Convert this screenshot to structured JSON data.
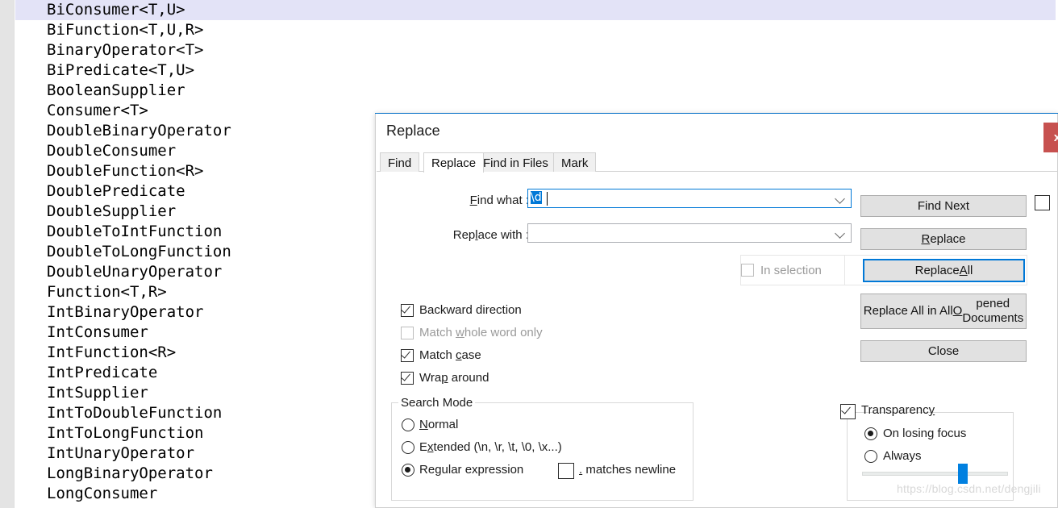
{
  "editor": {
    "lines": [
      "BiConsumer<T,U>",
      "BiFunction<T,U,R>",
      "BinaryOperator<T>",
      "BiPredicate<T,U>",
      "BooleanSupplier",
      "Consumer<T>",
      "DoubleBinaryOperator",
      "DoubleConsumer",
      "DoubleFunction<R>",
      "DoublePredicate",
      "DoubleSupplier",
      "DoubleToIntFunction",
      "DoubleToLongFunction",
      "DoubleUnaryOperator",
      "Function<T,R>",
      "IntBinaryOperator",
      "IntConsumer",
      "IntFunction<R>",
      "IntPredicate",
      "IntSupplier",
      "IntToDoubleFunction",
      "IntToLongFunction",
      "IntUnaryOperator",
      "LongBinaryOperator",
      "LongConsumer"
    ],
    "selected_line_index": 0,
    "selection_color": "#e3e3f7",
    "margin_color": "#e4e4e4"
  },
  "dialog": {
    "title": "Replace",
    "accent_color": "#0078d7",
    "close_label": "x",
    "close_color": "#c7514f",
    "tabs": [
      {
        "label": "Find",
        "active": false
      },
      {
        "label": "Replace",
        "active": true
      },
      {
        "label": "Find in Files",
        "active": false
      },
      {
        "label": "Mark",
        "active": false
      }
    ],
    "fields": {
      "find_what_label": "Find what :",
      "find_what_value": "\\d",
      "find_what_placeholder": "",
      "replace_with_label": "Replace with :",
      "replace_with_value": "",
      "replace_with_placeholder": ""
    },
    "buttons": {
      "find_next": "Find Next",
      "replace": "Replace",
      "replace_all": "Replace All",
      "replace_all_opened": "Replace All in All Opened Documents",
      "close": "Close"
    },
    "checkboxes": {
      "backward_direction": {
        "label": "Backward direction",
        "checked": true,
        "enabled": true
      },
      "match_whole_word": {
        "label": "Match whole word only",
        "checked": false,
        "enabled": false
      },
      "match_case": {
        "label": "Match case",
        "checked": true,
        "enabled": true
      },
      "wrap_around": {
        "label": "Wrap around",
        "checked": true,
        "enabled": true
      },
      "in_selection": {
        "label": "In selection",
        "checked": false,
        "enabled": false
      },
      "unlabeled_right": {
        "label": "",
        "checked": false,
        "enabled": true
      }
    },
    "search_mode": {
      "title": "Search Mode",
      "options": [
        {
          "label": "Normal",
          "selected": false
        },
        {
          "label": "Extended (\\n, \\r, \\t, \\0, \\x...)",
          "selected": false
        },
        {
          "label": "Regular expression",
          "selected": true
        }
      ],
      "dot_matches_newline": {
        "label": ". matches newline",
        "checked": false
      }
    },
    "transparency": {
      "label": "Transparency",
      "checked": true,
      "options": [
        {
          "label": "On losing focus",
          "selected": true
        },
        {
          "label": "Always",
          "selected": false
        }
      ],
      "slider_value": 66,
      "slider_color": "#0080e0"
    }
  },
  "watermark": "https://blog.csdn.net/dengjili"
}
